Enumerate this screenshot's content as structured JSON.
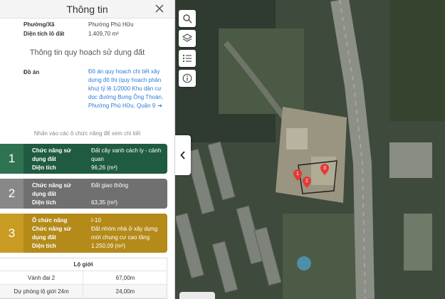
{
  "panel": {
    "title": "Thông tin",
    "ward": {
      "label": "Phường/Xã",
      "value": "Phường Phú Hữu"
    },
    "area": {
      "label": "Diện tích lô đất",
      "value": "1.409,70 m²"
    },
    "section_title": "Thông tin quy hoạch sử dụng đất",
    "project": {
      "label": "Đồ án",
      "link": "Đồ án quy hoạch chi tiết xây dựng đô thị (quy hoạch phân khu) tỷ lệ 1/2000 Khu dân cư dọc đường Bưng Ông Thoàn, Phường Phú Hữu, Quận 9"
    },
    "hint": "Nhấn vào các ô chức năng để xem chi tiết",
    "functions": [
      {
        "index": "1",
        "use_label": "Chức năng sử dụng đất",
        "use_value": "Đất cây xanh cách ly - cảnh quan",
        "area_label": "Diện tích",
        "area_value": "96,26 (m²)",
        "color": "#1f5b40"
      },
      {
        "index": "2",
        "use_label": "Chức năng sử dụng đất",
        "use_value": "Đất giao thông",
        "area_label": "Diện tích",
        "area_value": "63,35 (m²)",
        "color": "#707070"
      },
      {
        "index": "3",
        "plot_label": "Ô chức năng",
        "plot_value": "I-10",
        "use_label": "Chức năng sử dụng đất",
        "use_value": "Đất nhóm nhà ở xây dựng mới chung cư cao tầng",
        "area_label": "Diện tích",
        "area_value": "1.250,09 (m²)",
        "color": "#b48a19"
      }
    ],
    "setback": {
      "title": "Lộ giới",
      "rows": [
        {
          "name": "Vành đai 2",
          "value": "67,00m"
        },
        {
          "name": "Dự phòng lộ giới 24m",
          "value": "24,00m"
        }
      ]
    }
  },
  "map": {
    "tools": [
      "search-icon",
      "layers-icon",
      "legend-icon",
      "info-icon"
    ],
    "pins": [
      "1",
      "2",
      "3"
    ],
    "pin_color": "#e53935"
  }
}
